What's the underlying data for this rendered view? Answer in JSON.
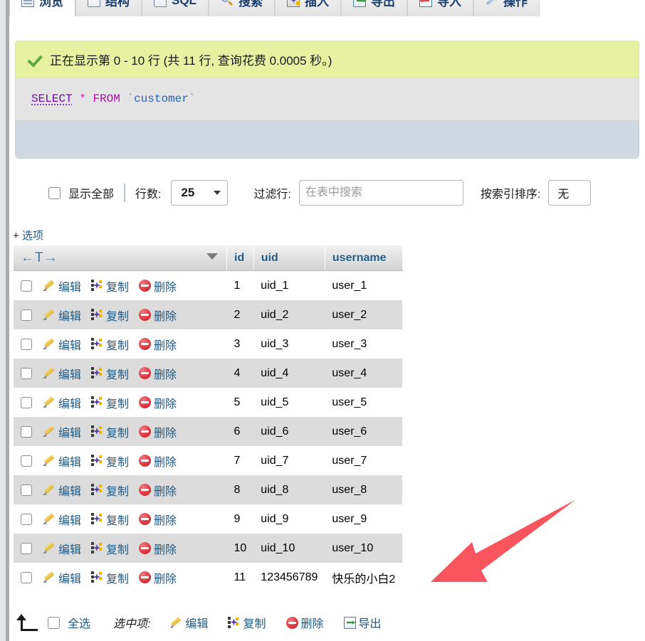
{
  "nav_tabs": [
    {
      "label": "浏览",
      "icon": "browse-icon",
      "active": true
    },
    {
      "label": "结构",
      "icon": "structure-icon",
      "active": false
    },
    {
      "label": "SQL",
      "icon": "sql-icon",
      "active": false
    },
    {
      "label": "搜索",
      "icon": "search-icon",
      "active": false
    },
    {
      "label": "插入",
      "icon": "insert-icon",
      "active": false
    },
    {
      "label": "导出",
      "icon": "export-icon",
      "active": false
    },
    {
      "label": "导入",
      "icon": "import-icon",
      "active": false
    },
    {
      "label": "操作",
      "icon": "operations-icon",
      "active": false
    }
  ],
  "success": {
    "icon": "check-icon",
    "text": "正在显示第 0 - 10 行 (共 11 行, 查询花费 0.0005 秒。)"
  },
  "sql": {
    "select": "SELECT",
    "star": "*",
    "from": "FROM",
    "backtick_open": "`",
    "table": "customer",
    "backtick_close": "`"
  },
  "controls": {
    "show_all_label": "显示全部",
    "rows_label": "行数:",
    "rows_value": "25",
    "filter_label": "过滤行:",
    "filter_value": "",
    "filter_placeholder": "在表中搜索",
    "sort_index_label": "按索引排序:",
    "sort_index_value": "无"
  },
  "options_link": {
    "plus": "+",
    "label": "选项"
  },
  "table": {
    "nav_left": "←",
    "nav_t": "T",
    "nav_right": "→",
    "columns": [
      "id",
      "uid",
      "username"
    ],
    "row_actions": {
      "edit": "编辑",
      "copy": "复制",
      "delete": "删除"
    },
    "rows": [
      {
        "id": "1",
        "uid": "uid_1",
        "username": "user_1"
      },
      {
        "id": "2",
        "uid": "uid_2",
        "username": "user_2"
      },
      {
        "id": "3",
        "uid": "uid_3",
        "username": "user_3"
      },
      {
        "id": "4",
        "uid": "uid_4",
        "username": "user_4"
      },
      {
        "id": "5",
        "uid": "uid_5",
        "username": "user_5"
      },
      {
        "id": "6",
        "uid": "uid_6",
        "username": "user_6"
      },
      {
        "id": "7",
        "uid": "uid_7",
        "username": "user_7"
      },
      {
        "id": "8",
        "uid": "uid_8",
        "username": "user_8"
      },
      {
        "id": "9",
        "uid": "uid_9",
        "username": "user_9"
      },
      {
        "id": "10",
        "uid": "uid_10",
        "username": "user_10"
      },
      {
        "id": "11",
        "uid": "123456789",
        "username": "快乐的小白2"
      }
    ]
  },
  "bottom_bar": {
    "select_all_label": "全选",
    "with_selected_label": "选中项:",
    "actions": [
      {
        "label": "编辑",
        "icon": "pencil-icon"
      },
      {
        "label": "复制",
        "icon": "copy-icon"
      },
      {
        "label": "删除",
        "icon": "delete-icon"
      },
      {
        "label": "导出",
        "icon": "export-icon"
      }
    ]
  },
  "annotation": {
    "arrow_color": "#f9555f"
  },
  "colors": {
    "success_bg": "#e6f2a2",
    "sql_bg": "#e4e4e4",
    "sql_actions_bg": "#d0d9e2",
    "link": "#235a81",
    "row_even": "#dcdcdc",
    "arrow": "#f9555f"
  }
}
